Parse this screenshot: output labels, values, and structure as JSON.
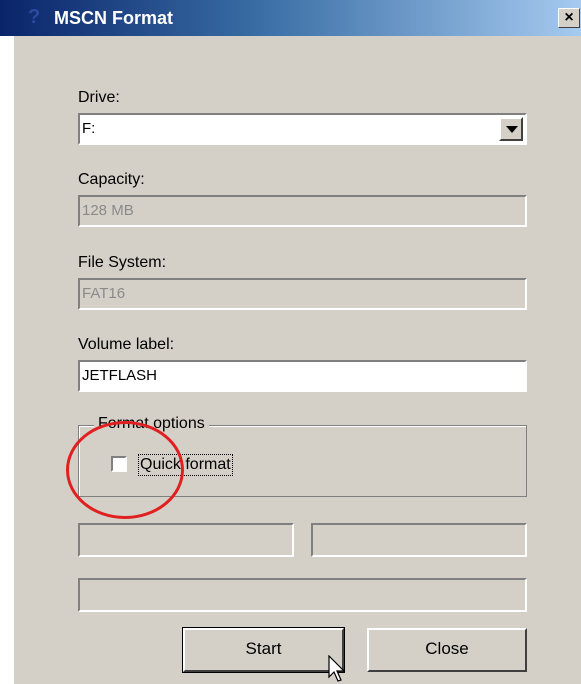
{
  "window": {
    "title": "MSCN Format",
    "close_label": "×",
    "icon": "question-drive-icon"
  },
  "drive": {
    "label": "Drive:",
    "value": "F:",
    "dropdown_icon": "chevron-down-icon"
  },
  "capacity": {
    "label": "Capacity:",
    "value": "128 MB"
  },
  "file_system": {
    "label": "File System:",
    "value": "FAT16"
  },
  "volume_label": {
    "label": "Volume label:",
    "value": "JETFLASH"
  },
  "format_options": {
    "legend": "Format options",
    "quick_format_label": "Quick format",
    "quick_format_checked": false
  },
  "buttons": {
    "start_label": "Start",
    "close_label": "Close"
  },
  "annotation": {
    "color": "#e02020"
  }
}
